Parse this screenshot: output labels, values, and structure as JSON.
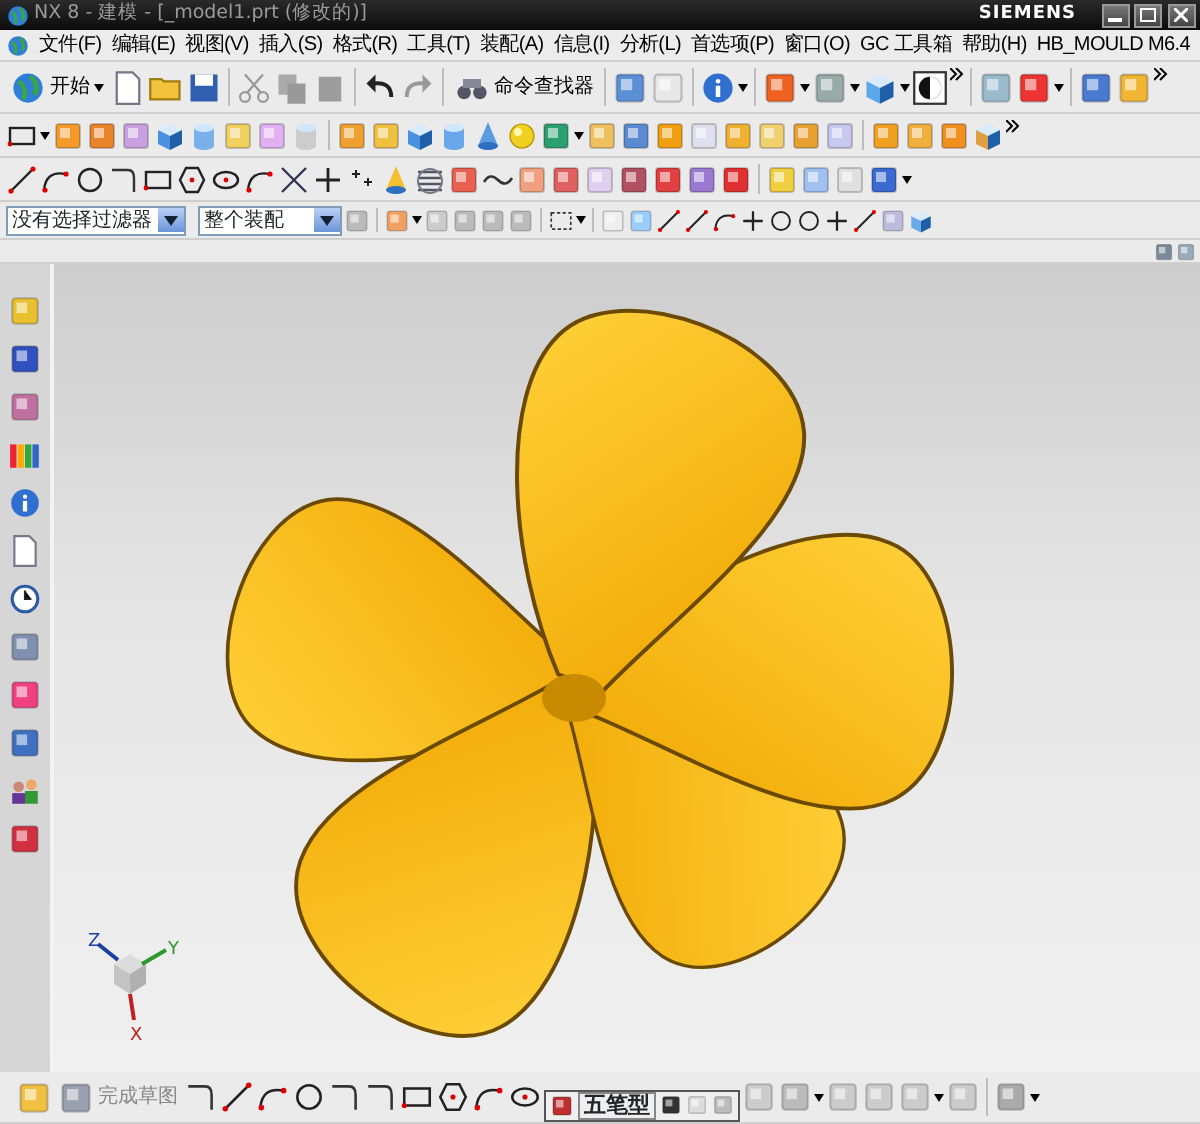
{
  "window": {
    "title": "NX 8 - 建模 - [_model1.prt (修改的)]",
    "brand": "SIEMENS"
  },
  "menu_bar": [
    "文件(F)",
    "编辑(E)",
    "视图(V)",
    "插入(S)",
    "格式(R)",
    "工具(T)",
    "装配(A)",
    "信息(I)",
    "分析(L)",
    "首选项(P)",
    "窗口(O)",
    "GC 工具箱",
    "帮助(H)",
    "HB_MOULD M6.4"
  ],
  "standard_toolbar": {
    "start_button": "开始",
    "command_finder": "命令查找器"
  },
  "selection_bar": {
    "type_filter": "没有选择过滤器",
    "scope": "整个装配"
  },
  "viewport": {
    "triad_labels": [
      "Z",
      "Y",
      "X"
    ]
  },
  "sketch_toolbar": {
    "finish_sketch": "完成草图"
  },
  "ime_bar": {
    "mode": "五笔型"
  }
}
